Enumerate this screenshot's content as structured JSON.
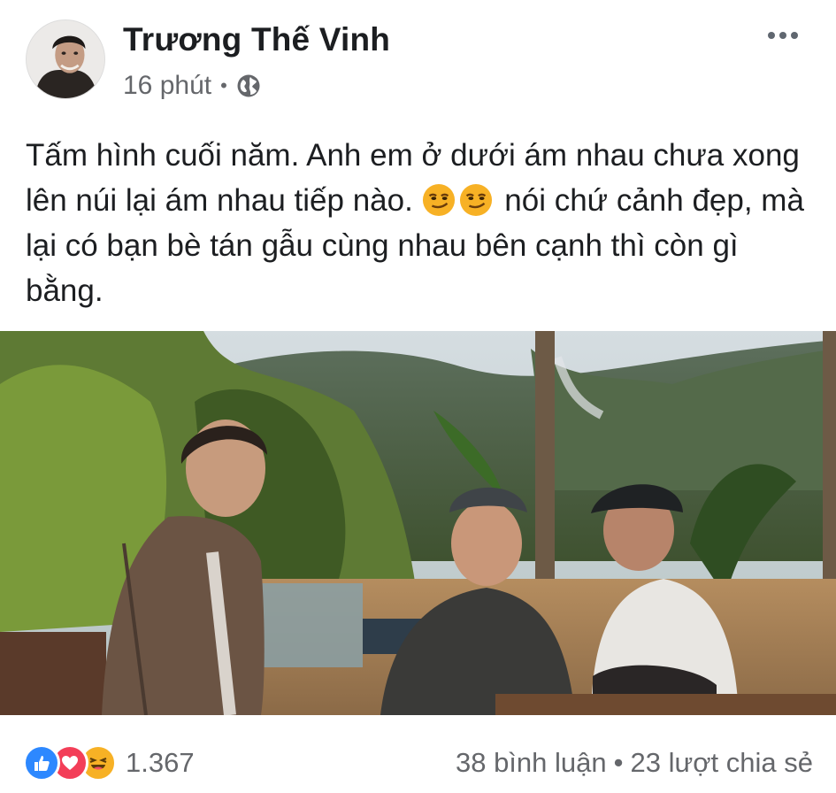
{
  "post": {
    "author": "Trương Thế Vinh",
    "time": "16 phút",
    "separator": "•",
    "privacy_icon": "globe-icon",
    "text_parts": {
      "line_a": "Tấm hình cuối năm. Anh em ở dưới ám nhau chưa xong lên núi lại ám nhau tiếp nào.",
      "emoji": "smirk-emoji",
      "line_b": "nói chứ cảnh đẹp, mà lại có bạn bè tán gẫu cùng nhau bên cạnh thì còn gì bằng."
    },
    "photo_icon": "photo-image"
  },
  "footer": {
    "reactions": [
      "like-icon",
      "love-icon",
      "haha-icon"
    ],
    "reaction_count": "1.367",
    "comments": "38 bình luận",
    "dot": "•",
    "shares": "23 lượt chia sẻ"
  },
  "colors": {
    "like": "#2d88ff",
    "love": "#f33e58",
    "haha": "#f7b125",
    "meta_text": "#65676b"
  }
}
